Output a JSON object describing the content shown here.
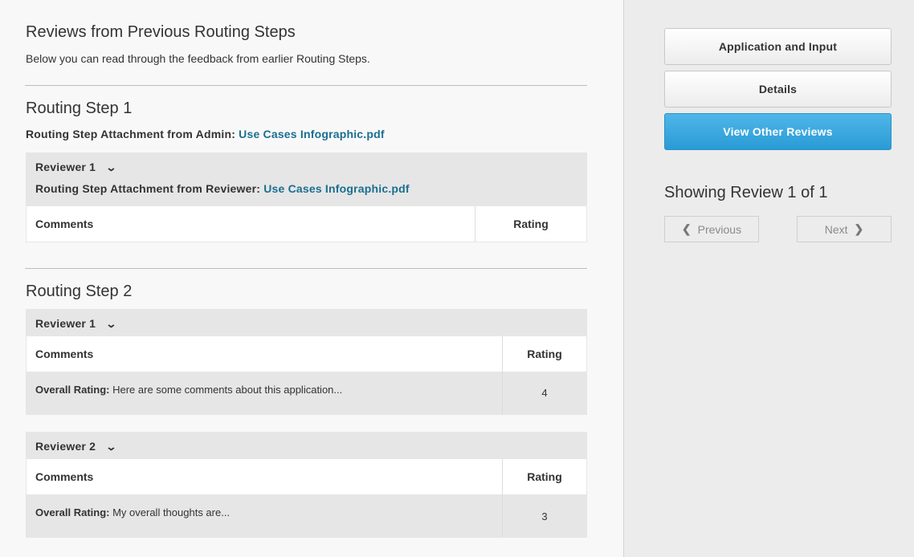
{
  "main": {
    "title": "Reviews from Previous Routing Steps",
    "subtitle": "Below you can read through the feedback from earlier Routing Steps."
  },
  "step1": {
    "title": "Routing Step 1",
    "attach_label": "Routing Step Attachment from Admin:",
    "attach_link": "Use Cases Infographic.pdf",
    "reviewer": {
      "label": "Reviewer 1",
      "attach_label": "Routing Step Attachment from Reviewer:",
      "attach_link": "Use Cases Infographic.pdf",
      "col_comments": "Comments",
      "col_rating": "Rating"
    }
  },
  "step2": {
    "title": "Routing Step 2",
    "reviewers": [
      {
        "label": "Reviewer 1",
        "col_comments": "Comments",
        "col_rating": "Rating",
        "comment_label": "Overall Rating:",
        "comment_text": "Here are some comments about this application...",
        "rating": "4"
      },
      {
        "label": "Reviewer 2",
        "col_comments": "Comments",
        "col_rating": "Rating",
        "comment_label": "Overall Rating:",
        "comment_text": "My overall thoughts are...",
        "rating": "3"
      }
    ]
  },
  "sidebar": {
    "btn_app": "Application and Input",
    "btn_details": "Details",
    "btn_reviews": "View Other Reviews",
    "showing": "Showing Review 1 of 1",
    "prev": "Previous",
    "next": "Next",
    "active_color": "#2a9bd6"
  },
  "icons": {
    "chevron": "chevron-down-icon",
    "prev": "chevron-left-icon",
    "next": "chevron-right-icon"
  }
}
